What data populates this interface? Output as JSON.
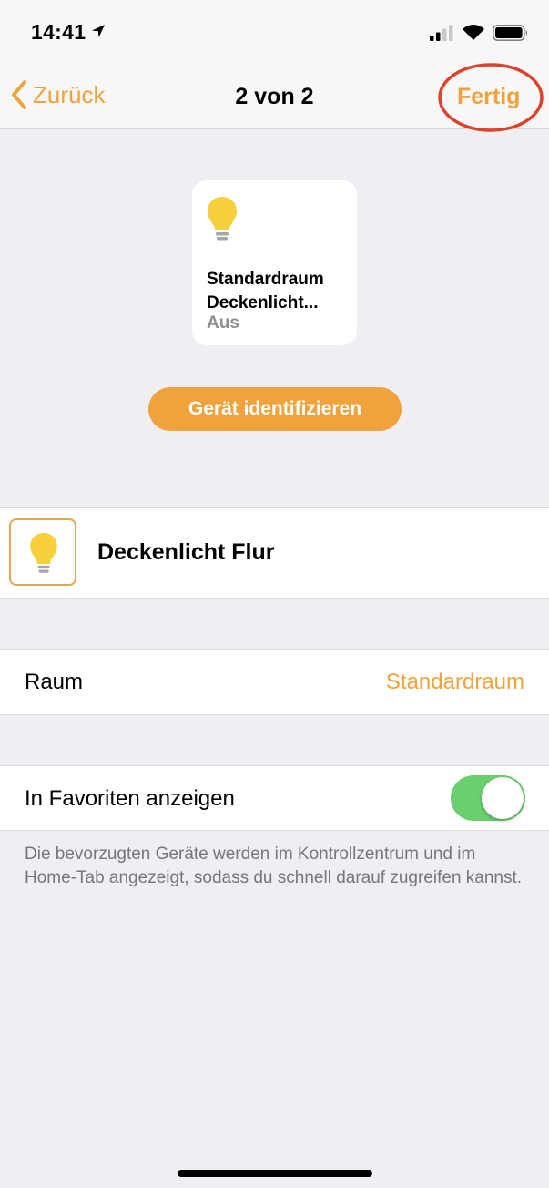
{
  "status_bar": {
    "time": "14:41"
  },
  "nav": {
    "back_label": "Zurück",
    "title": "2 von 2",
    "done_label": "Fertig"
  },
  "tile": {
    "name": "Standardraum\nDeckenlicht...",
    "state": "Aus"
  },
  "identify_label": "Gerät identifizieren",
  "device": {
    "name": "Deckenlicht Flur"
  },
  "room": {
    "label": "Raum",
    "value": "Standardraum"
  },
  "favorites": {
    "label": "In Favoriten anzeigen",
    "enabled": true
  },
  "footnote": "Die bevorzugten Geräte werden im Kontrollzentrum und im Home-Tab angezeigt, sodass du schnell darauf zugreifen kannst.",
  "colors": {
    "accent": "#f0a33c",
    "toggle_on": "#6ad06f",
    "bulb": "#f7d13c",
    "highlight": "#e0412b"
  },
  "icons": [
    "location-arrow-icon",
    "signal-icon",
    "wifi-icon",
    "battery-icon",
    "chevron-left-icon",
    "lightbulb-icon"
  ]
}
